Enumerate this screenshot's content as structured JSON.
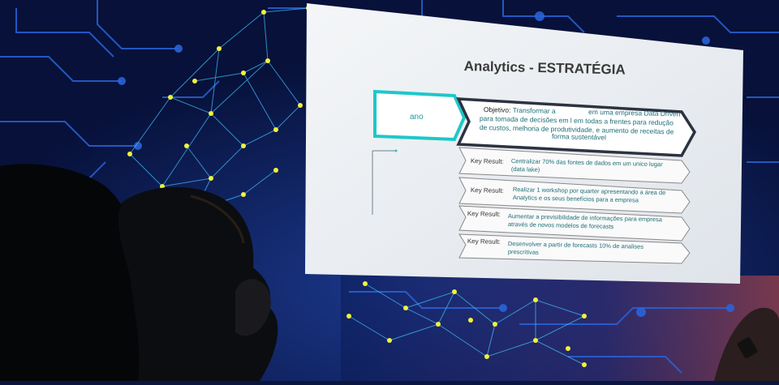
{
  "slide": {
    "title": "Analytics - ESTRATÉGIA",
    "left_box_label": "ano",
    "objective": {
      "label": "Objetivo:",
      "line1a": "Transformar a",
      "line1b": "em uma empresa Data Driven",
      "line2": "para tomada de decisões em l em todas a frentes para redução",
      "line3": "de custos, melhoria de produtividade, e aumento de receitas de",
      "line4": "forma sustentável"
    },
    "key_results": [
      {
        "label": "Key Result:",
        "line1": "Centralizar 70% das fontes de dados em um unico lugar",
        "line2": "(data lake)"
      },
      {
        "label": "Key Result:",
        "line1": "Realizar 1 workshop por quarter apresentando a área de",
        "line2": "Analytics e os seus benefícios para a empresa"
      },
      {
        "label": "Key Result:",
        "line1": "Aumentar a previsibilidade de informações para empresa",
        "line2": "através de novos modelos de forecasts"
      },
      {
        "label": "Key Result:",
        "line1": "Desenvolver a partir de forecasts 10% de analises",
        "line2": "prescritivas"
      }
    ]
  },
  "colors": {
    "background": "#0a1640",
    "circuit": "#2a63d8",
    "node": "#f2f23a",
    "network_line": "#3fc3ff",
    "teal_accent": "#1fc7c9",
    "dark_chevron": "#2c3340"
  }
}
